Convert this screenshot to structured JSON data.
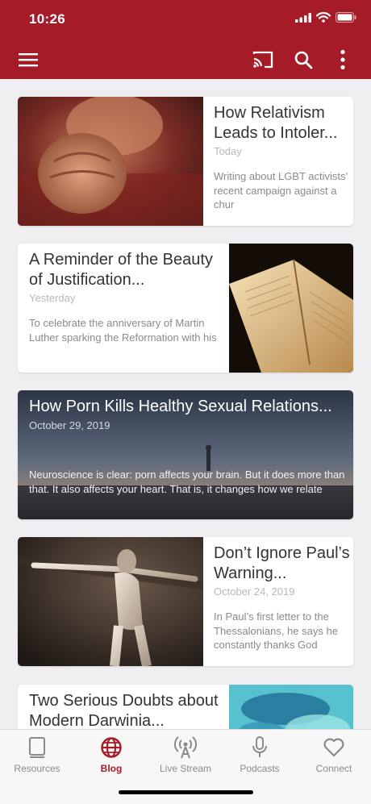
{
  "status_bar": {
    "time": "10:26"
  },
  "toolbar": {
    "icons": [
      "menu-icon",
      "cast-icon",
      "search-icon",
      "more-vertical-icon"
    ]
  },
  "feed": {
    "posts": [
      {
        "title": "How Relativism Leads to Intoler...",
        "date": "Today",
        "excerpt": "Writing about LGBT activists’ recent campaign against a chur"
      },
      {
        "title": "A Reminder of the Beauty of Justification...",
        "date": "Yesterday",
        "excerpt": "To celebrate the anniversary of Martin Luther sparking the Reformation with his"
      },
      {
        "title": "How Porn Kills Healthy Sexual Relations...",
        "date": "October 29, 2019",
        "excerpt": "Neuroscience is clear: porn affects your brain. But it does more than that. It also affects your heart. That is, it changes how we relate"
      },
      {
        "title": "Don’t Ignore Paul’s Warning...",
        "date": "October 24, 2019",
        "excerpt": "In Paul’s first letter to the Thessalonians, he says he constantly thanks God"
      },
      {
        "title": "Two Serious Doubts about Modern Darwinia...",
        "date": "",
        "excerpt": ""
      }
    ]
  },
  "tabs": [
    {
      "label": "Resources",
      "icon": "book-icon",
      "active": false
    },
    {
      "label": "Blog",
      "icon": "globe-icon",
      "active": true
    },
    {
      "label": "Live Stream",
      "icon": "broadcast-icon",
      "active": false
    },
    {
      "label": "Podcasts",
      "icon": "microphone-icon",
      "active": false
    },
    {
      "label": "Connect",
      "icon": "heart-icon",
      "active": false
    }
  ],
  "colors": {
    "brand": "#a51c28",
    "background": "#efeff1",
    "inactive_tab": "#8a8a8a"
  }
}
